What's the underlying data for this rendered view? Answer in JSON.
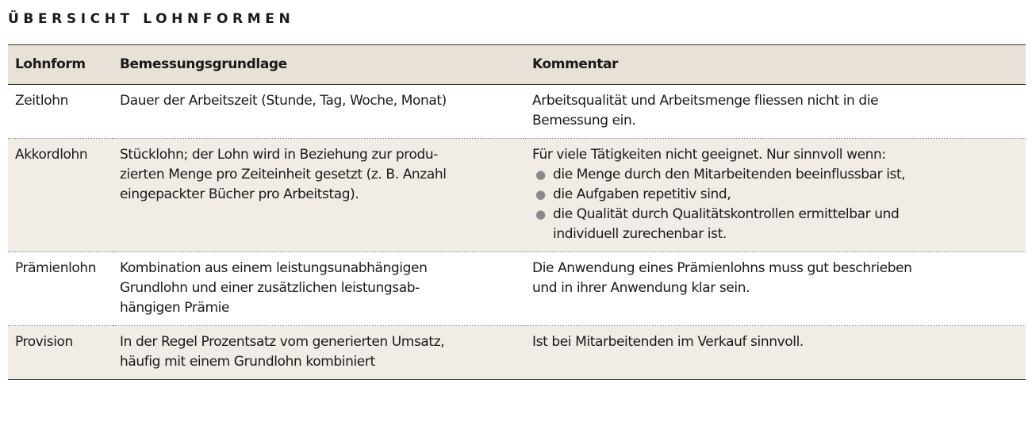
{
  "title": "ÜBERSICHT LOHNFORMEN",
  "table": {
    "headers": [
      "Lohnform",
      "Bemessungsgrundlage",
      "Kommentar"
    ],
    "rows": [
      {
        "lohnform": "Zeitlohn",
        "grundlage": [
          "Dauer der Arbeitszeit (Stunde, Tag, Woche, Monat)"
        ],
        "kommentar": [
          "Arbeitsqualität und Arbeitsmenge fliessen nicht in die",
          "Bemessung ein."
        ],
        "bullets": []
      },
      {
        "lohnform": "Akkordlohn",
        "grundlage": [
          "Stücklohn; der Lohn wird in Beziehung zur produ-",
          "zierten Menge pro Zeiteinheit gesetzt (z. B. Anzahl",
          "eingepackter Bücher pro Arbeitstag)."
        ],
        "kommentar": [
          "Für viele Tätigkeiten nicht geeignet. Nur sinnvoll wenn:"
        ],
        "bullets": [
          [
            "die Menge durch den Mitarbeitenden beeinflussbar ist,"
          ],
          [
            "die Aufgaben repetitiv sind,"
          ],
          [
            "die Qualität durch Qualitätskontrollen ermittelbar und",
            "individuell zurechenbar ist."
          ]
        ]
      },
      {
        "lohnform": "Prämienlohn",
        "grundlage": [
          "Kombination aus einem leistungsunabhängigen",
          "Grundlohn und einer zusätzlichen leistungsab-",
          "hängigen Prämie"
        ],
        "kommentar": [
          "Die Anwendung eines Prämienlohns muss gut beschrieben",
          "und in ihrer Anwendung klar sein."
        ],
        "bullets": []
      },
      {
        "lohnform": "Provision",
        "grundlage": [
          "In der Regel Prozentsatz vom generierten Umsatz,",
          "häufig mit einem Grundlohn kombiniert"
        ],
        "kommentar": [
          "Ist bei Mitarbeitenden im Verkauf sinnvoll."
        ],
        "bullets": []
      }
    ]
  },
  "colors": {
    "header_bg": "#e8e1d8",
    "shaded_row_bg": "#f1ece6",
    "bullet": "#8a8a8a"
  }
}
